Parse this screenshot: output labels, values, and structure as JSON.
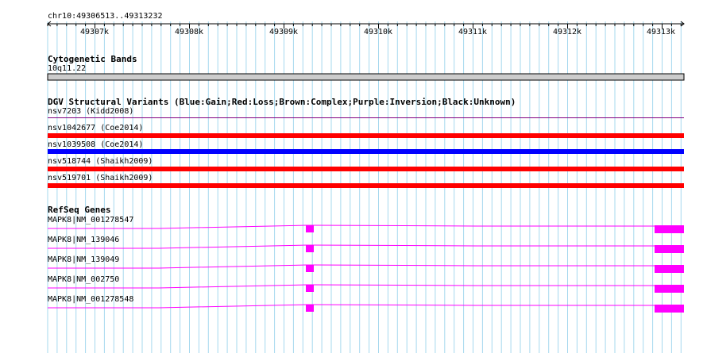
{
  "ruler": {
    "coordinates": "chr10:49306513..49313232",
    "ticks": [
      "49307k",
      "49308k",
      "49309k",
      "49310k",
      "49311k",
      "49312k",
      "49313k"
    ]
  },
  "cytoband": {
    "title": "Cytogenetic Bands",
    "band": "10q11.22"
  },
  "dgv": {
    "title": "DGV Structural Variants (Blue:Gain;Red:Loss;Brown:Complex;Purple:Inversion;Black:Unknown)",
    "variants": [
      {
        "label": "nsv7203 (Kidd2008)",
        "type": "Inversion",
        "color": "#800080"
      },
      {
        "label": "nsv1042677 (Coe2014)",
        "type": "Loss",
        "color": "#ff0000"
      },
      {
        "label": "nsv1039508 (Coe2014)",
        "type": "Gain",
        "color": "#0000ff"
      },
      {
        "label": "nsv518744 (Shaikh2009)",
        "type": "Loss",
        "color": "#ff0000"
      },
      {
        "label": "nsv519701 (Shaikh2009)",
        "type": "Loss",
        "color": "#ff0000"
      }
    ]
  },
  "refseq": {
    "title": "RefSeq Genes",
    "color": "#ff00ff",
    "transcripts": [
      {
        "label": "MAPK8|NM_001278547"
      },
      {
        "label": "MAPK8|NM_139046"
      },
      {
        "label": "MAPK8|NM_139049"
      },
      {
        "label": "MAPK8|NM_002750"
      },
      {
        "label": "MAPK8|NM_001278548"
      }
    ]
  },
  "colors": {
    "grid": "#a6d8ee",
    "cytoband_fill": "#cccccc"
  }
}
